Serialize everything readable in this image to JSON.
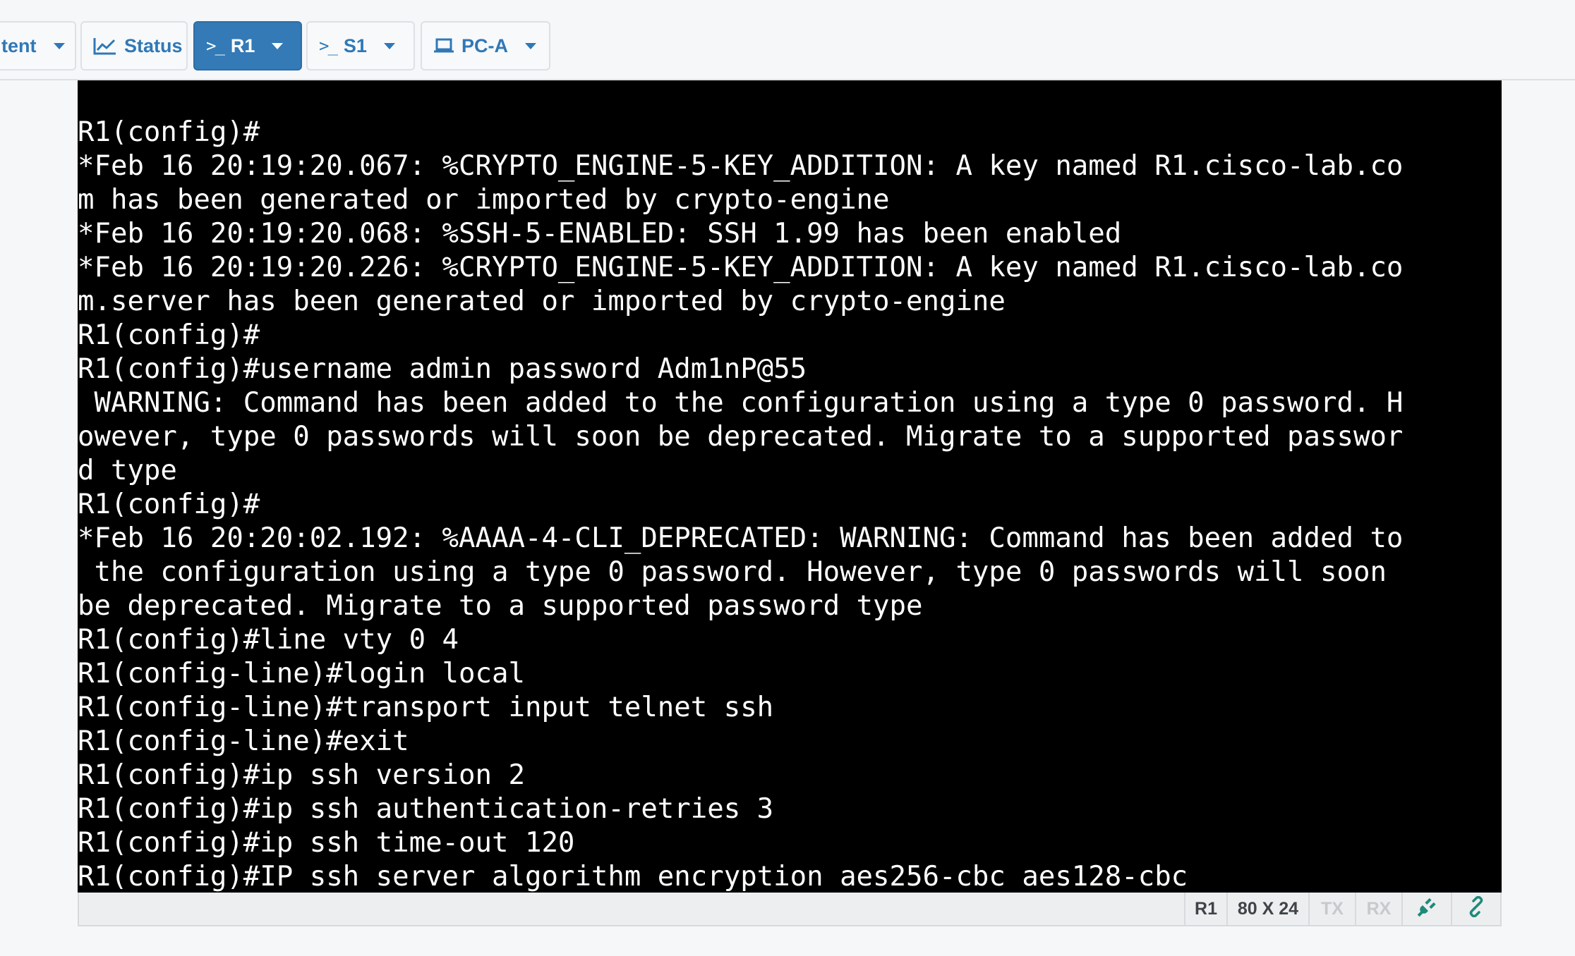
{
  "tabs": [
    {
      "label": "tent",
      "icon": "none",
      "active": false
    },
    {
      "label": "Status",
      "icon": "chart-line-icon",
      "active": false
    },
    {
      "label": "R1",
      "icon": "terminal-prompt-icon",
      "active": true
    },
    {
      "label": "S1",
      "icon": "terminal-prompt-icon",
      "active": false
    },
    {
      "label": "PC-A",
      "icon": "laptop-icon",
      "active": false
    }
  ],
  "terminal": {
    "lines": [
      "R1(config)#",
      "*Feb 16 20:19:20.067: %CRYPTO_ENGINE-5-KEY_ADDITION: A key named R1.cisco-lab.co",
      "m has been generated or imported by crypto-engine",
      "*Feb 16 20:19:20.068: %SSH-5-ENABLED: SSH 1.99 has been enabled",
      "*Feb 16 20:19:20.226: %CRYPTO_ENGINE-5-KEY_ADDITION: A key named R1.cisco-lab.co",
      "m.server has been generated or imported by crypto-engine",
      "R1(config)#",
      "R1(config)#username admin password Adm1nP@55",
      " WARNING: Command has been added to the configuration using a type 0 password. H",
      "owever, type 0 passwords will soon be deprecated. Migrate to a supported passwor",
      "d type",
      "R1(config)#",
      "*Feb 16 20:20:02.192: %AAAA-4-CLI_DEPRECATED: WARNING: Command has been added to",
      " the configuration using a type 0 password. However, type 0 passwords will soon",
      "be deprecated. Migrate to a supported password type",
      "R1(config)#line vty 0 4",
      "R1(config-line)#login local",
      "R1(config-line)#transport input telnet ssh",
      "R1(config-line)#exit",
      "R1(config)#ip ssh version 2",
      "R1(config)#ip ssh authentication-retries 3",
      "R1(config)#ip ssh time-out 120",
      "R1(config)#IP ssh server algorithm encryption aes256-cbc aes128-cbc"
    ]
  },
  "statusbar": {
    "device": "R1",
    "size": "80 X 24",
    "tx": "TX",
    "rx": "RX",
    "icons": [
      "plug-icon",
      "link-icon"
    ],
    "colors": {
      "connected": "#1e8a7a",
      "dim": "#c6cacd"
    }
  }
}
